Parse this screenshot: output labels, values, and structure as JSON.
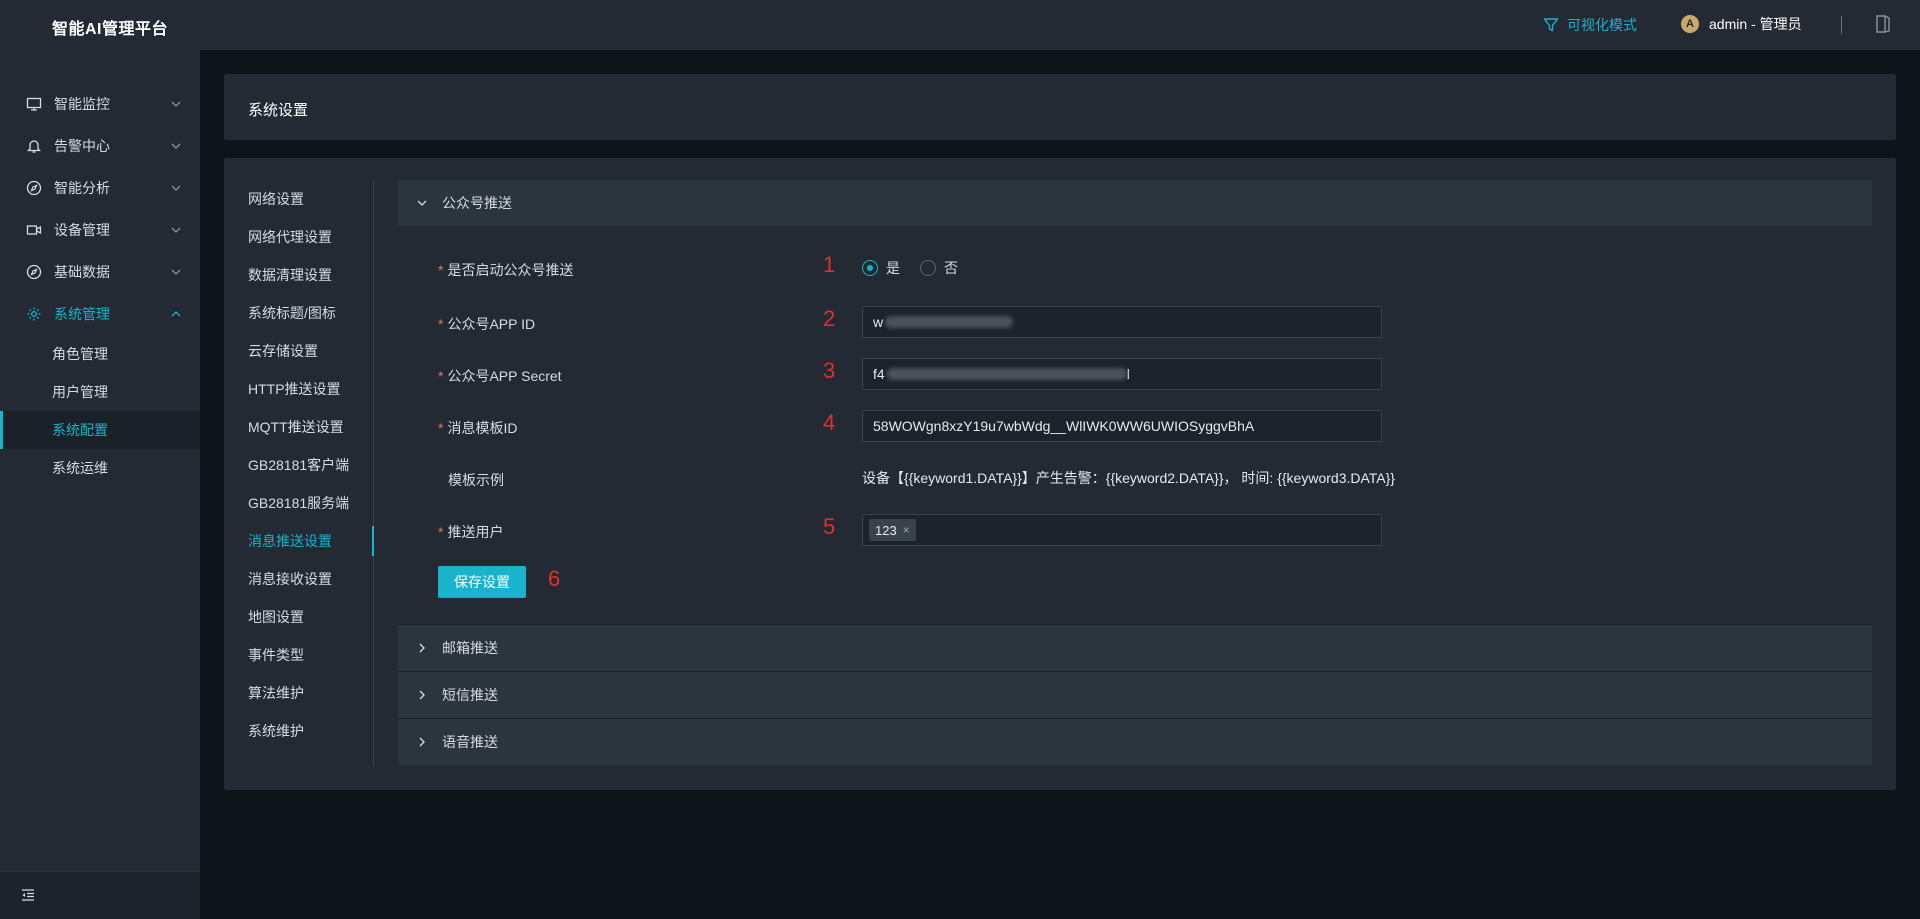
{
  "app": {
    "title": "智能AI管理平台"
  },
  "topbar": {
    "viz_mode": "可视化模式",
    "avatar_letter": "A",
    "user_label": "admin - 管理员"
  },
  "sidebar": {
    "items": [
      {
        "label": "智能监控",
        "icon": "monitor-icon"
      },
      {
        "label": "告警中心",
        "icon": "bell-icon"
      },
      {
        "label": "智能分析",
        "icon": "compass-icon"
      },
      {
        "label": "设备管理",
        "icon": "camera-icon"
      },
      {
        "label": "基础数据",
        "icon": "compass-icon"
      },
      {
        "label": "系统管理",
        "icon": "gear-icon"
      }
    ],
    "sub_items": [
      "角色管理",
      "用户管理",
      "系统配置",
      "系统运维"
    ]
  },
  "page": {
    "title": "系统设置"
  },
  "settings_menu": [
    "网络设置",
    "网络代理设置",
    "数据清理设置",
    "系统标题/图标",
    "云存储设置",
    "HTTP推送设置",
    "MQTT推送设置",
    "GB28181客户端",
    "GB28181服务端",
    "消息推送设置",
    "消息接收设置",
    "地图设置",
    "事件类型",
    "算法维护",
    "系统维护"
  ],
  "wechat_push": {
    "section_title": "公众号推送",
    "enable_label": "是否启动公众号推送",
    "yes": "是",
    "no": "否",
    "app_id_label": "公众号APP ID",
    "app_id_value": "w",
    "app_secret_label": "公众号APP Secret",
    "app_secret_value_start": "f4",
    "app_secret_value_end": "l",
    "template_id_label": "消息模板ID",
    "template_id_value": "58WOWgn8xzY19u7wbWdg__WlIWK0WW6UWIOSyggvBhA",
    "template_example_label": "模板示例",
    "template_example_value": "设备【{{keyword1.DATA}}】产生告警：{{keyword2.DATA}}， 时间: {{keyword3.DATA}}",
    "push_users_label": "推送用户",
    "push_user_tag": "123",
    "save_button": "保存设置",
    "markers": [
      "1",
      "2",
      "3",
      "4",
      "5",
      "6"
    ]
  },
  "other_sections": [
    "邮箱推送",
    "短信推送",
    "语音推送"
  ],
  "colors": {
    "accent": "#1bb3cc",
    "required": "#f56c6c",
    "marker": "#e0302f"
  }
}
